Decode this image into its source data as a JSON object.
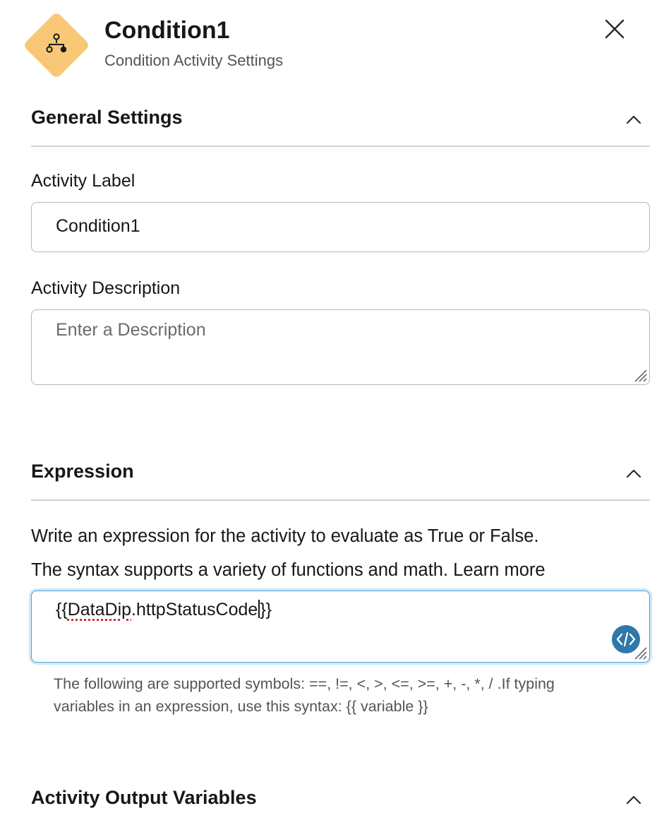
{
  "header": {
    "title": "Condition1",
    "subtitle": "Condition Activity Settings",
    "icon": "condition-flow-icon",
    "icon_color": "#f8c876"
  },
  "general_settings": {
    "title": "General Settings",
    "activity_label": {
      "label": "Activity Label",
      "value": "Condition1"
    },
    "activity_description": {
      "label": "Activity Description",
      "placeholder": "Enter a Description",
      "value": ""
    }
  },
  "expression": {
    "title": "Expression",
    "help_line1": "Write an expression for the activity to evaluate as True or False.",
    "help_line2": "The syntax supports a variety of functions and math. Learn more",
    "value_open": "{{",
    "value_flagged": "DataDip",
    "value_rest": ".httpStatusCode",
    "value_close": "}}",
    "note_line1": "The following are supported symbols: ==, !=, <, >, <=, >=, +, -, *, / .If typing",
    "note_line2": "variables in an expression, use this syntax: {{ variable }}",
    "focus_color": "#49a3dd",
    "code_button_color": "#2f78a8"
  },
  "output_variables": {
    "title": "Activity Output Variables"
  }
}
